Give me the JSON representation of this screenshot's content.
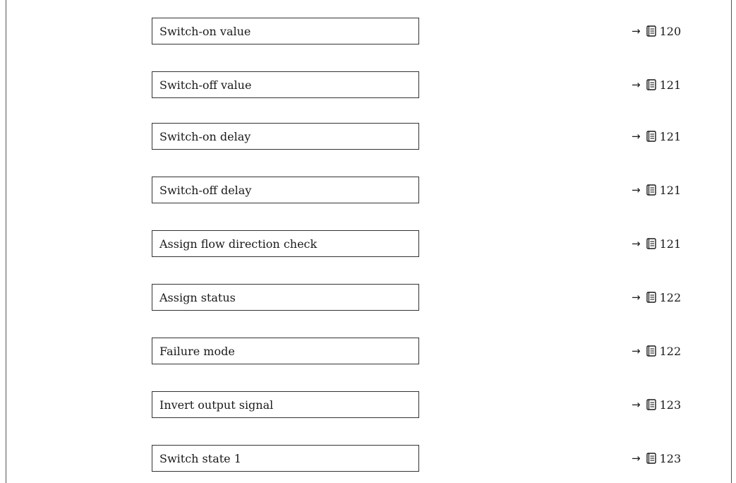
{
  "rows": [
    {
      "label": "Switch-on value",
      "page": "120"
    },
    {
      "label": "Switch-off value",
      "page": "121"
    },
    {
      "label": "Switch-on delay",
      "page": "121"
    },
    {
      "label": "Switch-off delay",
      "page": "121"
    },
    {
      "label": "Assign flow direction check",
      "page": "121"
    },
    {
      "label": "Assign status",
      "page": "122"
    },
    {
      "label": "Failure mode",
      "page": "122"
    },
    {
      "label": "Invert output signal",
      "page": "123"
    },
    {
      "label": "Switch state 1",
      "page": "123"
    }
  ],
  "icons": {
    "reference_arrow": "right-arrow-icon",
    "page_reference": "book-icon"
  },
  "arrow_glyph": "→"
}
